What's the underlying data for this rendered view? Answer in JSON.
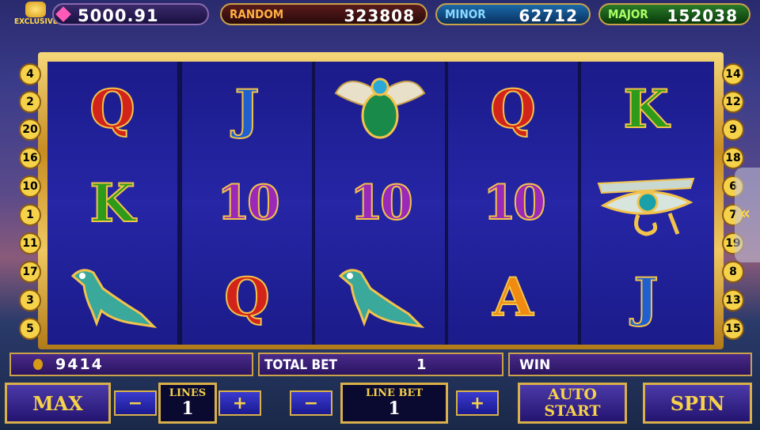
{
  "top_bar": {
    "exclusive_label": "EXCLUSIVE",
    "balance": "5000.91",
    "jackpots": [
      {
        "label": "RANDOM",
        "value": "323808"
      },
      {
        "label": "MINOR",
        "value": "62712"
      },
      {
        "label": "MAJOR",
        "value": "152038"
      }
    ]
  },
  "reels": [
    [
      "Q",
      "K",
      "falcon"
    ],
    [
      "J",
      "10",
      "Q"
    ],
    [
      "scarab",
      "10",
      "falcon"
    ],
    [
      "Q",
      "10",
      "A"
    ],
    [
      "K",
      "eye-of-horus",
      "J"
    ]
  ],
  "line_markers_left": [
    "4",
    "2",
    "20",
    "16",
    "10",
    "1",
    "11",
    "17",
    "3",
    "5"
  ],
  "line_markers_right": [
    "14",
    "12",
    "9",
    "18",
    "6",
    "7",
    "19",
    "8",
    "13",
    "15"
  ],
  "side_tab": {
    "label": "«"
  },
  "info_bar": {
    "credits": "9414",
    "total_bet_label": "TOTAL BET",
    "total_bet_value": "1",
    "win_label": "WIN",
    "win_value": ""
  },
  "controls": {
    "max_label": "MAX",
    "minus": "−",
    "plus": "+",
    "lines_label": "LINES",
    "lines_value": "1",
    "line_bet_label": "LINE BET",
    "line_bet_value": "1",
    "auto_start_label_1": "AUTO",
    "auto_start_label_2": "START",
    "spin_label": "SPIN"
  },
  "colors": {
    "gold": "#d9b04a",
    "reel_blue": "#2626a6"
  }
}
